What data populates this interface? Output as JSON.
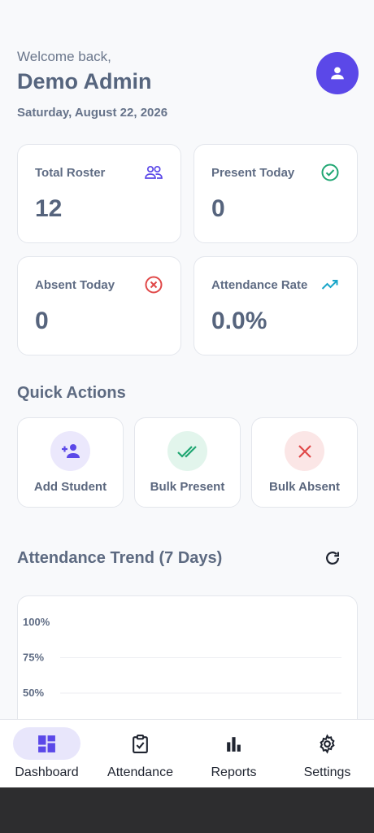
{
  "header": {
    "welcome": "Welcome back,",
    "user_name": "Demo Admin",
    "date": "Saturday, August 22, 2026",
    "avatar_icon": "person-icon"
  },
  "stats": [
    {
      "label": "Total Roster",
      "value": "12",
      "icon": "people-icon",
      "color": "#5b48e8"
    },
    {
      "label": "Present Today",
      "value": "0",
      "icon": "check-circle-icon",
      "color": "#1fa672"
    },
    {
      "label": "Absent Today",
      "value": "0",
      "icon": "x-circle-icon",
      "color": "#e04848"
    },
    {
      "label": "Attendance Rate",
      "value": "0.0%",
      "icon": "trending-up-icon",
      "color": "#1aa6c9"
    }
  ],
  "quick_actions": {
    "title": "Quick Actions",
    "items": [
      {
        "label": "Add Student",
        "icon": "add-person-icon",
        "color": "#5b48e8",
        "bg": "#ebe8fc"
      },
      {
        "label": "Bulk Present",
        "icon": "double-check-icon",
        "color": "#1fa672",
        "bg": "#e2f5ec"
      },
      {
        "label": "Bulk Absent",
        "icon": "close-icon",
        "color": "#e04848",
        "bg": "#fbe6e6"
      }
    ]
  },
  "trend": {
    "title": "Attendance Trend (7 Days)",
    "refresh_icon": "refresh-icon"
  },
  "chart_data": {
    "type": "line",
    "title": "Attendance Trend (7 Days)",
    "y_tick_labels": [
      "100%",
      "75%",
      "50%"
    ],
    "series": []
  },
  "nav": {
    "items": [
      {
        "label": "Dashboard",
        "icon": "dashboard-icon",
        "active": true
      },
      {
        "label": "Attendance",
        "icon": "clipboard-check-icon",
        "active": false
      },
      {
        "label": "Reports",
        "icon": "bar-chart-icon",
        "active": false
      },
      {
        "label": "Settings",
        "icon": "gear-icon",
        "active": false
      }
    ]
  },
  "colors": {
    "accent": "#5b48e8",
    "text": "#56657e"
  }
}
